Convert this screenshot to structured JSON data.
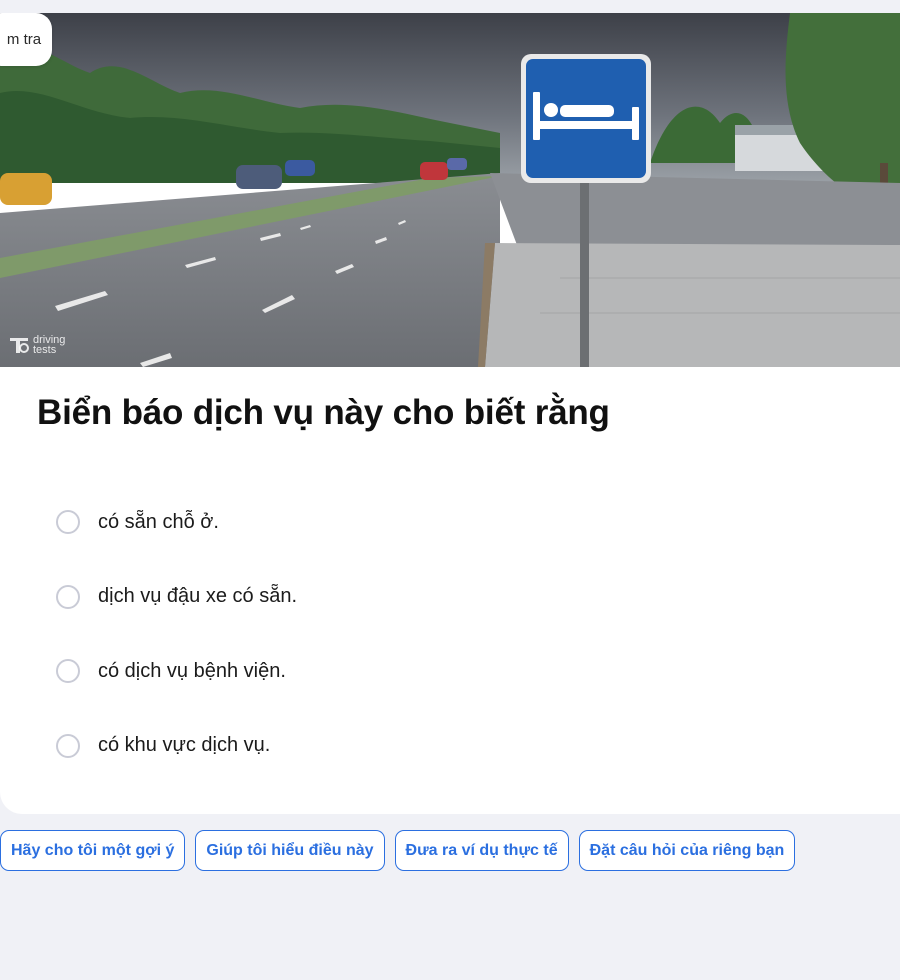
{
  "header": {
    "badge_text": "Kiểm tra",
    "badge_visible_text": "m tra",
    "watermark": [
      "driving",
      "tests"
    ]
  },
  "question": {
    "title": "Biển báo dịch vụ này cho biết rằng",
    "image_icon": "hotel-bed-sign",
    "options": [
      {
        "label": "có sẵn chỗ ở.",
        "selected": false
      },
      {
        "label": "dịch vụ đậu xe có sẵn.",
        "selected": false
      },
      {
        "label": "có dịch vụ bệnh viện.",
        "selected": false
      },
      {
        "label": "có khu vực dịch vụ.",
        "selected": false
      }
    ]
  },
  "assistant": {
    "suggestions": [
      "Hãy cho tôi một gợi ý",
      "Giúp tôi hiểu điều này",
      "Đưa ra ví dụ thực tế",
      "Đặt câu hỏi của riêng bạn"
    ]
  },
  "colors": {
    "accent": "#2b6fe0",
    "page_bg": "#f0f1f6",
    "sign_blue": "#1f5fb0"
  }
}
